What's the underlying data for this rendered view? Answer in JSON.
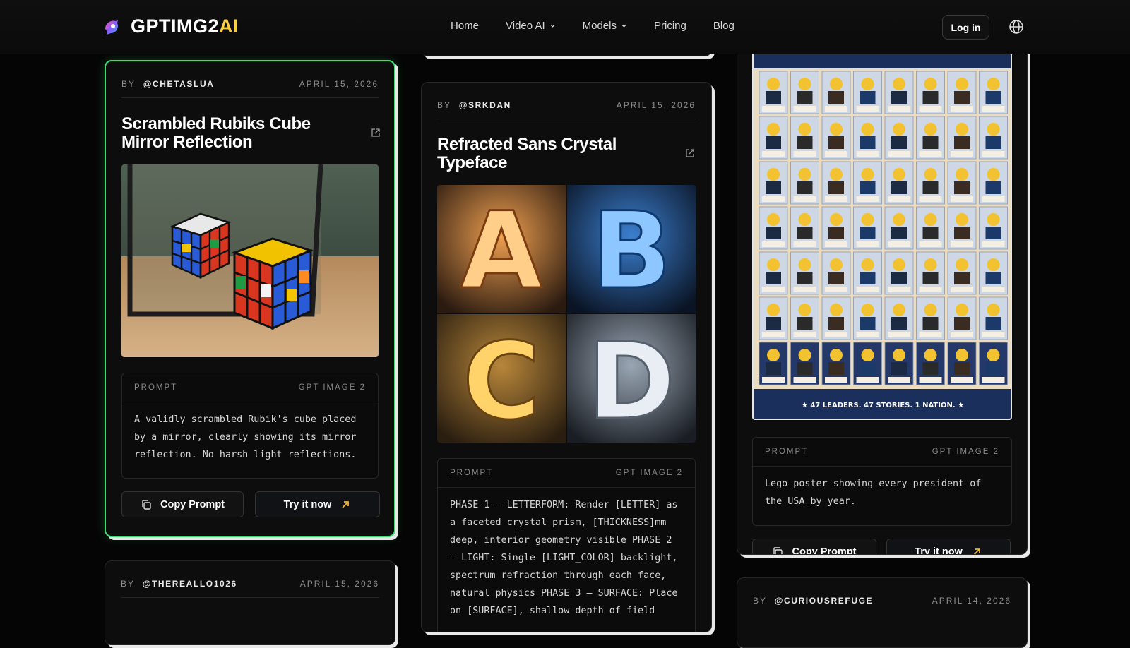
{
  "brand": {
    "name_main": "GPTIMG2",
    "name_accent": "AI"
  },
  "nav": {
    "links": [
      {
        "label": "Home",
        "dropdown": false
      },
      {
        "label": "Video AI",
        "dropdown": true
      },
      {
        "label": "Models",
        "dropdown": true
      },
      {
        "label": "Pricing",
        "dropdown": false
      },
      {
        "label": "Blog",
        "dropdown": false
      }
    ],
    "login_label": "Log in"
  },
  "cards": {
    "rubiks": {
      "by": "BY",
      "author": "@CHETASLUA",
      "date": "APRIL 15, 2026",
      "title": "Scrambled Rubiks Cube Mirror Reflection",
      "prompt_label": "PROMPT",
      "model": "GPT IMAGE 2",
      "prompt": "A validly scrambled Rubik's cube placed by a mirror, clearly showing its mirror reflection. No harsh light reflections.",
      "copy_label": "Copy Prompt",
      "try_label": "Try it now"
    },
    "crystal": {
      "by": "BY",
      "author": "@SRKDAN",
      "date": "APRIL 15, 2026",
      "title": "Refracted Sans Crystal Typeface",
      "letters": [
        "A",
        "B",
        "C",
        "D"
      ],
      "prompt_label": "PROMPT",
      "model": "GPT IMAGE 2",
      "prompt": "PHASE 1 — LETTERFORM: Render [LETTER] as a faceted crystal prism, [THICKNESS]mm deep, interior geometry visible PHASE 2 — LIGHT: Single [LIGHT_COLOR] backlight, spectrum refraction through each face, natural physics PHASE 3 — SURFACE: Place on [SURFACE], shallow depth of field"
    },
    "lego": {
      "banner": "★ 47 LEADERS. 47 STORIES. 1 NATION. ★",
      "prompt_label": "PROMPT",
      "model": "GPT IMAGE 2",
      "prompt": "Lego poster showing every president of the USA by year.",
      "copy_label": "Copy Prompt",
      "try_label": "Try it now"
    },
    "thereallo": {
      "by": "BY",
      "author": "@THEREALLO1026",
      "date": "APRIL 15, 2026"
    },
    "curious": {
      "by": "BY",
      "author": "@CURIOUSREFUGE",
      "date": "APRIL 14, 2026"
    }
  },
  "colors": {
    "accent_green": "#3ddc6f",
    "brand_yellow": "#f7d046",
    "arrow_orange": "#f2b233"
  }
}
